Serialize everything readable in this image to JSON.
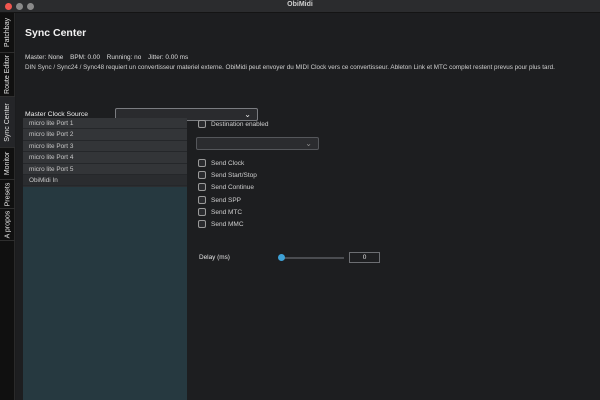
{
  "window": {
    "title": "ObiMidi"
  },
  "sidebar": {
    "tabs": [
      {
        "label": "Patchbay",
        "active": false
      },
      {
        "label": "Route Editor",
        "active": false
      },
      {
        "label": "Sync Center",
        "active": true
      },
      {
        "label": "Monitor",
        "active": false
      },
      {
        "label": "Presets",
        "active": false
      },
      {
        "label": "A propos",
        "active": false
      }
    ]
  },
  "main": {
    "title": "Sync Center",
    "status": {
      "master": "Master: None",
      "bpm": "BPM: 0.00",
      "running": "Running: no",
      "jitter": "Jitter: 0.00 ms"
    },
    "notice": "DIN Sync / Sync24 / Sync48 requiert un convertisseur materiel externe. ObiMidi peut envoyer du MIDI Clock vers ce convertisseur. Ableton Link et MTC complet restent prevus pour plus tard.",
    "master_clock": {
      "label": "Master Clock Source",
      "value": ""
    },
    "ports": [
      "micro lite Port 1",
      "micro lite Port 2",
      "micro lite Port 3",
      "micro lite Port 4",
      "micro lite Port 5",
      "ObiMidi In"
    ],
    "destination_enabled": {
      "label": "Destination enabled",
      "checked": false
    },
    "destination_select": {
      "value": ""
    },
    "send_options": [
      {
        "label": "Send Clock",
        "checked": false
      },
      {
        "label": "Send Start/Stop",
        "checked": false
      },
      {
        "label": "Send Continue",
        "checked": false
      },
      {
        "label": "Send SPP",
        "checked": false
      },
      {
        "label": "Send MTC",
        "checked": false
      },
      {
        "label": "Send MMC",
        "checked": false
      }
    ],
    "delay": {
      "label": "Delay (ms)",
      "value": "0"
    }
  },
  "colors": {
    "accent": "#3ea1d6",
    "close": "#f0564f"
  },
  "icons": {
    "dropdown": "chevron-down-icon"
  }
}
